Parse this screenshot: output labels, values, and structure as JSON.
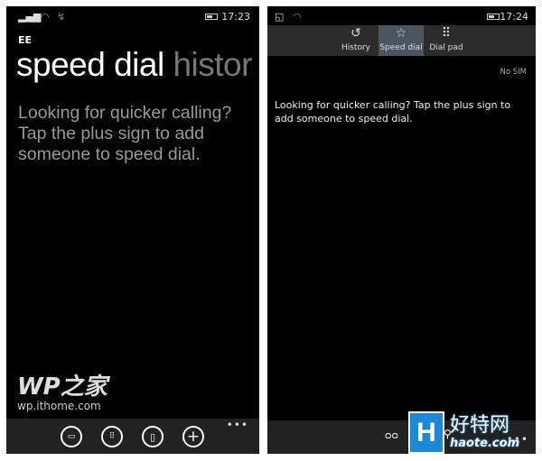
{
  "left_phone": {
    "status": {
      "time": "17:23",
      "icons": [
        "signal-icon",
        "wifi-icon",
        "sync-icon",
        "battery-icon"
      ]
    },
    "carrier": "EE",
    "pivot": {
      "active": "speed dial",
      "inactive": "histor"
    },
    "message": "Looking for quicker calling? Tap the plus sign to add someone to speed dial.",
    "watermark": {
      "logo": "WP之家",
      "url": "wp.ithome.com"
    },
    "appbar": {
      "buttons": [
        "voicemail-icon",
        "dialpad-icon",
        "contacts-icon",
        "add-icon"
      ],
      "more": "•••"
    }
  },
  "right_phone": {
    "status": {
      "time": "17:24",
      "icons": [
        "notification-icon",
        "wifi-icon",
        "battery-icon"
      ]
    },
    "tabs": [
      {
        "label": "History",
        "icon": "history-icon"
      },
      {
        "label": "Speed dial",
        "icon": "star-icon",
        "active": true
      },
      {
        "label": "Dial pad",
        "icon": "dialpad-icon"
      }
    ],
    "sim_status": "No SIM",
    "message": "Looking for quicker calling? Tap the plus sign to add someone to speed dial.",
    "appbar": {
      "buttons": [
        "voicemail-icon",
        "search-icon"
      ],
      "more": "•••"
    }
  },
  "badge": {
    "letter": "H",
    "cn": "好特网",
    "en": "haote.com",
    "color": "#1e88d8"
  }
}
